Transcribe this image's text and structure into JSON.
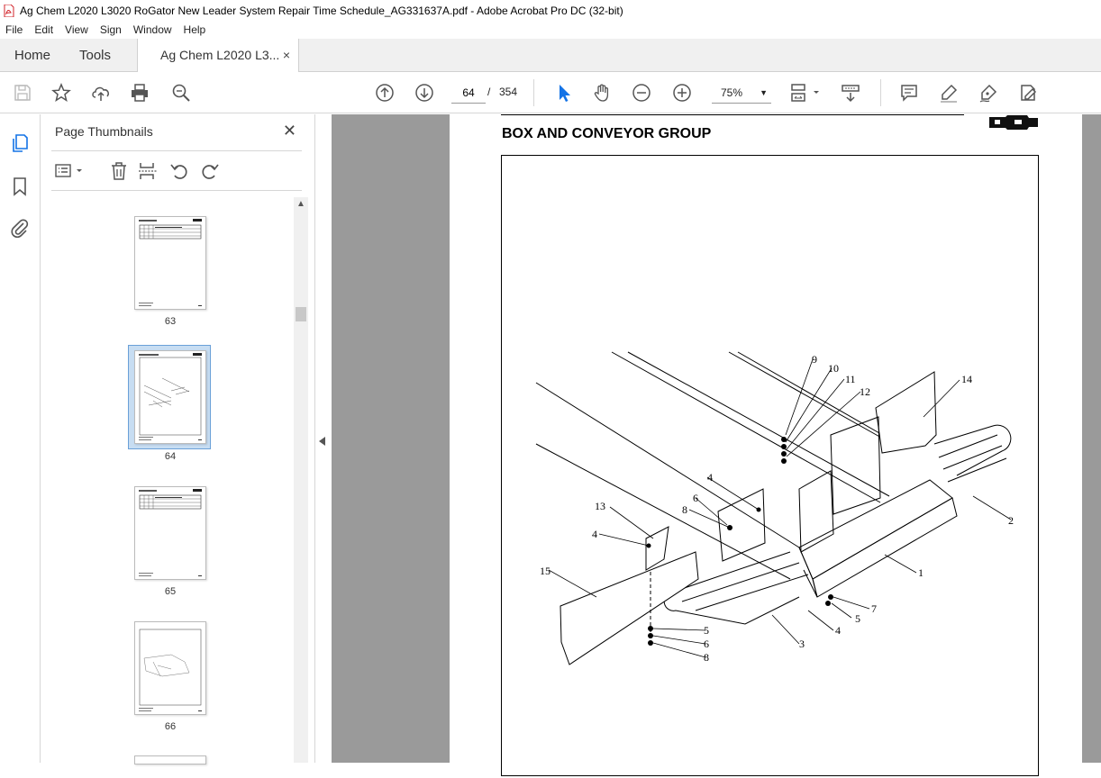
{
  "window": {
    "title": "Ag Chem L2020 L3020 RoGator New Leader System Repair Time Schedule_AG331637A.pdf - Adobe Acrobat Pro DC (32-bit)"
  },
  "menu": [
    "File",
    "Edit",
    "View",
    "Sign",
    "Window",
    "Help"
  ],
  "tabs": {
    "home": "Home",
    "tools": "Tools",
    "document": "Ag Chem L2020 L3...",
    "close": "×"
  },
  "toolbar": {
    "current_page": "64",
    "separator": "/",
    "total_pages": "354",
    "zoom": "75%"
  },
  "icons": {
    "save": "save-icon",
    "bookmark_star": "star-icon",
    "share": "upload-icon",
    "print": "print-icon",
    "find": "zoom-search-icon",
    "prev_page": "arrow-up-circle-icon",
    "next_page": "arrow-down-circle-icon",
    "select": "cursor-arrow-icon",
    "hand": "hand-icon",
    "zoom_out": "minus-circle-icon",
    "zoom_in": "plus-circle-icon",
    "page_fit": "page-fit-icon",
    "scroll_mode": "scroll-mode-icon",
    "comment": "comment-icon",
    "highlight": "highlighter-icon",
    "sign": "pen-sign-icon",
    "edit": "edit-pdf-icon"
  },
  "panel": {
    "title": "Page Thumbnails",
    "close": "✕",
    "thumbnails": [
      {
        "label": "63"
      },
      {
        "label": "64"
      },
      {
        "label": "65"
      },
      {
        "label": "66"
      }
    ]
  },
  "document": {
    "heading": "BOX AND CONVEYOR GROUP",
    "callouts": [
      "9",
      "10",
      "11",
      "12",
      "14",
      "2",
      "1",
      "7",
      "5",
      "4",
      "3",
      "5",
      "6",
      "8",
      "4",
      "13",
      "4",
      "6",
      "8",
      "15"
    ]
  },
  "colors": {
    "accent": "#1473e6",
    "selection_bg": "#c7ddf2",
    "doc_bg": "#9a9a9a",
    "pdf_red": "#d2232a"
  }
}
